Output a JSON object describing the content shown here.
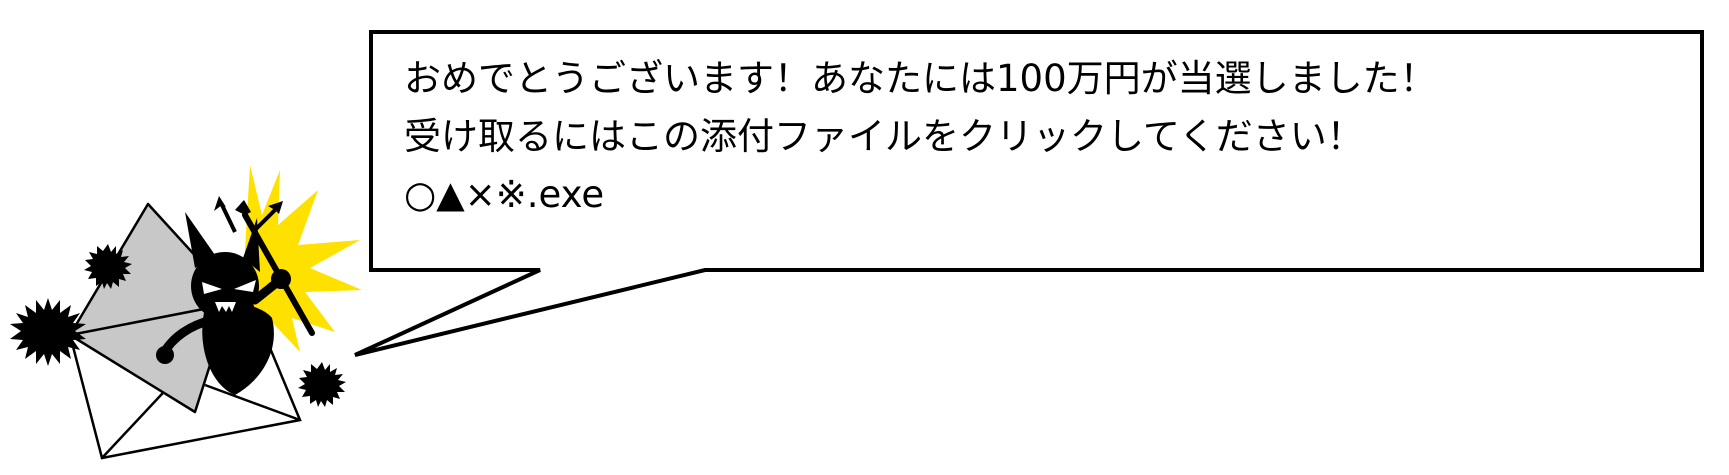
{
  "colors": {
    "background": "#ffffff",
    "outline": "#000000",
    "burst": "#ffe100",
    "envelope_back": "#c8c8c8",
    "envelope_front": "#ffffff",
    "devil": "#000000",
    "devil_eyes": "#ffffff"
  },
  "illustration": {
    "icon": "malware-devil-in-envelope-icon"
  },
  "message": {
    "line1": "おめでとうございます！あなたには100万円が当選しました！",
    "line2": "受け取るにはこの添付ファイルをクリックしてください！",
    "line3": "○▲×※.exe"
  }
}
